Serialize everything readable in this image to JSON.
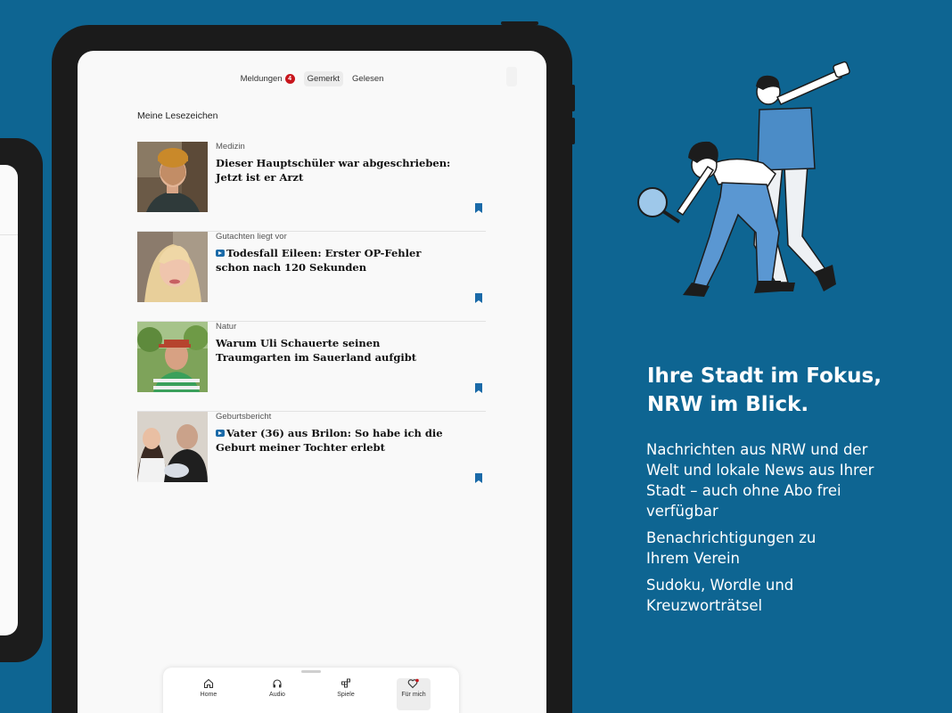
{
  "tabs": [
    {
      "label": "Meldungen",
      "badge": "4"
    },
    {
      "label": "Gemerkt"
    },
    {
      "label": "Gelesen"
    }
  ],
  "section_title": "Meine Lesezeichen",
  "articles": [
    {
      "kicker": "Medizin",
      "headline": "Dieser Hauptschüler war abgeschrieben: Jetzt ist er Arzt",
      "plus": false
    },
    {
      "kicker": "Gutachten liegt vor",
      "headline": "Todesfall Eileen: Erster OP-Fehler schon nach 120 Sekunden",
      "plus": true
    },
    {
      "kicker": "Natur",
      "headline": "Warum Uli Schauerte seinen Traumgarten im Sauerland aufgibt",
      "plus": false
    },
    {
      "kicker": "Geburtsbericht",
      "headline": "Vater (36) aus Brilon: So habe ich die Geburt meiner Tochter erlebt",
      "plus": true
    }
  ],
  "nav": [
    {
      "label": "Home",
      "icon": "home-icon"
    },
    {
      "label": "Audio",
      "icon": "headphones-icon"
    },
    {
      "label": "Spiele",
      "icon": "puzzle-icon"
    },
    {
      "label": "Für mich",
      "icon": "heart-icon"
    }
  ],
  "promo": {
    "headline_line1": "Ihre Stadt im Fokus,",
    "headline_line2": "NRW im Blick.",
    "features": [
      "Nachrichten aus NRW und der Welt und lokale News aus Ihrer Stadt – auch ohne Abo frei verfügbar",
      "Benachrichtigungen zu Ihrem Verein",
      "Sudoku, Wordle und Kreuzworträtsel"
    ]
  },
  "colors": {
    "background": "#0e6592",
    "accent": "#1a6aa8",
    "badge": "#c8161d"
  }
}
